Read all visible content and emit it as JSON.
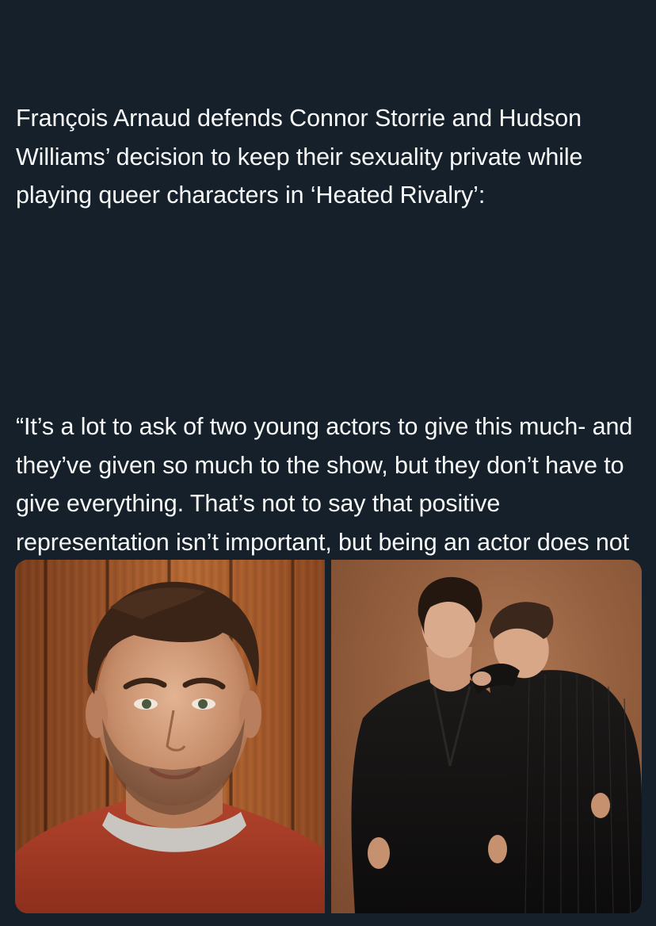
{
  "tweet": {
    "paragraph_1": "François Arnaud defends Connor Storrie and Hudson Williams’ decision to keep their sexuality private while playing queer characters in ‘Heated Rivalry’:",
    "paragraph_2": "“It’s a lot to ask of two young actors to give this much- and they’ve given so much to the show, but they don’t have to give everything. That’s not to say that positive representation isn’t important, but being an actor does not oblige you to share your private life. If you want to do it, great. If you don’t, then that doesn’t have to be your mission.”"
  },
  "media": {
    "photos": [
      {
        "subject": "portrait-man-red-sweater"
      },
      {
        "subject": "two-men-dark-suits"
      }
    ]
  },
  "colors": {
    "background": "#15202b",
    "text": "#f7f9f9"
  }
}
